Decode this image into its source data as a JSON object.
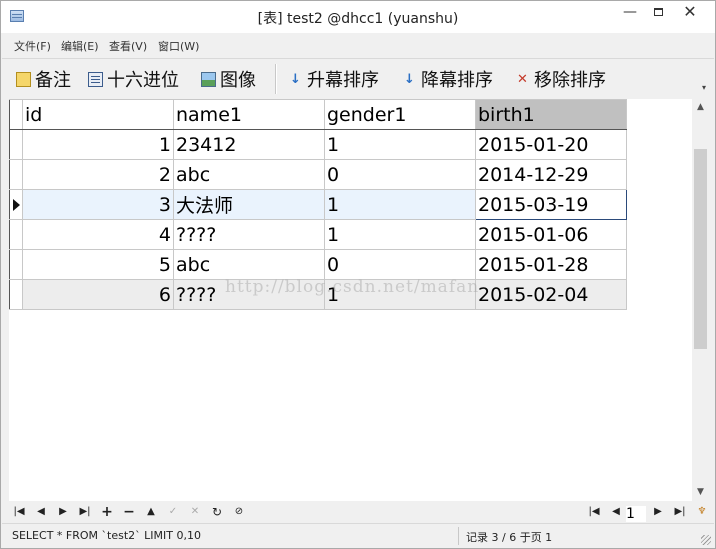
{
  "window": {
    "title": "[表] test2 @dhcc1 (yuanshu)",
    "min_glyph": "—",
    "close_glyph": "✕"
  },
  "menu": {
    "items": [
      "文件(F)",
      "编辑(E)",
      "查看(V)",
      "窗口(W)"
    ]
  },
  "toolbar": {
    "buttons": [
      {
        "label": "备注",
        "icon": "note-icon"
      },
      {
        "label": "十六进位",
        "icon": "hex-grid-icon"
      },
      {
        "label": "图像",
        "icon": "image-icon"
      },
      {
        "label": "升幕排序",
        "icon": "sort-asc-icon"
      },
      {
        "label": "降幕排序",
        "icon": "sort-desc-icon"
      },
      {
        "label": "移除排序",
        "icon": "remove-sort-icon"
      }
    ],
    "dropdown_glyph": "▾"
  },
  "grid": {
    "columns": [
      "id",
      "name1",
      "gender1",
      "birth1"
    ],
    "sorted_column": "birth1",
    "rows": [
      {
        "id": "1",
        "name1": "23412",
        "gender1": "1",
        "birth1": "2015-01-20"
      },
      {
        "id": "2",
        "name1": "abc",
        "gender1": "0",
        "birth1": "2014-12-29"
      },
      {
        "id": "3",
        "name1": "大法师",
        "gender1": "1",
        "birth1": "2015-03-19"
      },
      {
        "id": "4",
        "name1": "????",
        "gender1": "1",
        "birth1": "2015-01-06"
      },
      {
        "id": "5",
        "name1": "abc",
        "gender1": "0",
        "birth1": "2015-01-28"
      },
      {
        "id": "6",
        "name1": "????",
        "gender1": "1",
        "birth1": "2015-02-04"
      }
    ],
    "selected_row_index": 2
  },
  "watermark": "http://blog.csdn.net/mafan",
  "navbar": {
    "page_number": "1"
  },
  "status": {
    "sql": "SELECT * FROM `test2` LIMIT 0,10",
    "record": "记录 3 / 6 于页 1"
  },
  "colors": {
    "selected_row": "#eaf3fd",
    "sorted_header": "#c0c0c0",
    "window_bg": "#f0f0f0"
  }
}
